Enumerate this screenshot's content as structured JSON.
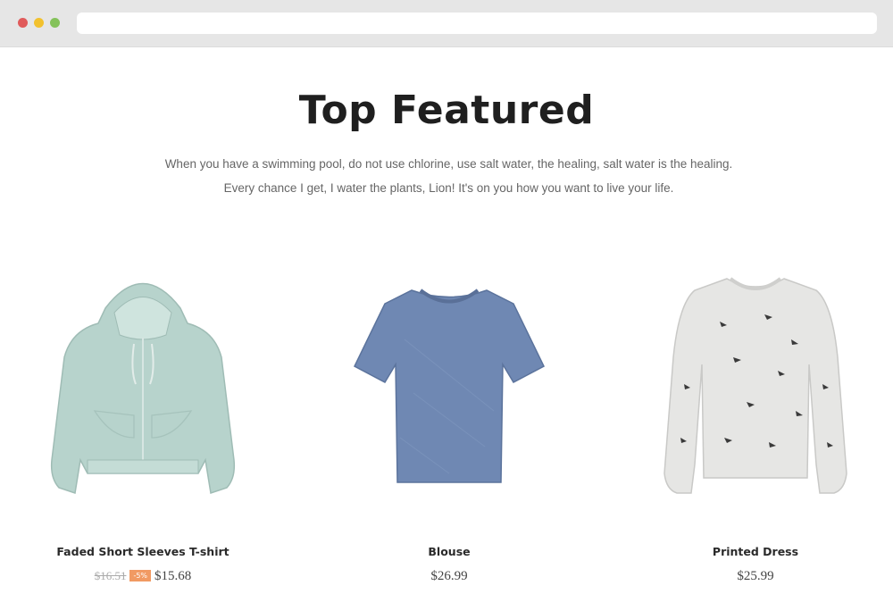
{
  "browser": {
    "url": ""
  },
  "section": {
    "title": "Top Featured",
    "description": "When you have a swimming pool, do not use chlorine, use salt water, the healing, salt water is the healing. Every chance I get, I water the plants, Lion! It's on you how you want to live your life."
  },
  "products": [
    {
      "name": "Faded Short Sleeves T-shirt",
      "old_price": "$16.51",
      "discount": "-5%",
      "price": "$15.68",
      "image": "mint-zip-hoodie"
    },
    {
      "name": "Blouse",
      "price": "$26.99",
      "image": "blue-heather-tshirt"
    },
    {
      "name": "Printed Dress",
      "price": "$25.99",
      "image": "bird-print-sweatshirt"
    }
  ],
  "colors": {
    "discount_badge": "#f19a63",
    "hoodie": "#b7d3cc",
    "tshirt": "#6f88b3",
    "sweatshirt": "#e6e6e4"
  }
}
